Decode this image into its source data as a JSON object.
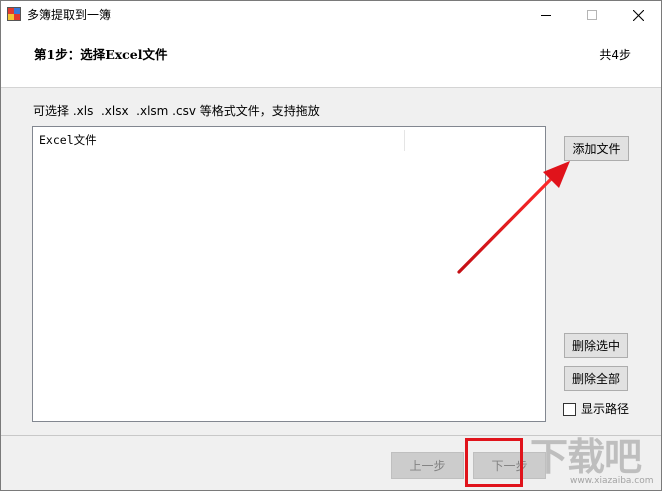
{
  "window": {
    "title": "多簿提取到一簿"
  },
  "header": {
    "step_title": "第1步：选择Excel文件",
    "step_count": "共4步"
  },
  "hint": "可选择 .xls  .xlsx  .xlsm .csv 等格式文件，支持拖放",
  "file_list": {
    "columns": [
      "Excel文件"
    ],
    "rows": []
  },
  "buttons": {
    "add_file": "添加文件",
    "delete_selected": "删除选中",
    "delete_all": "删除全部",
    "prev_step": "上一步",
    "next_step": "下一步"
  },
  "show_path": {
    "label": "显示路径",
    "checked": false
  },
  "annotation": {
    "arrow_color": "#e0131b",
    "box_color": "#e0131b"
  },
  "watermark": {
    "text": "下载吧",
    "url": "www.xiazaiba.com"
  }
}
